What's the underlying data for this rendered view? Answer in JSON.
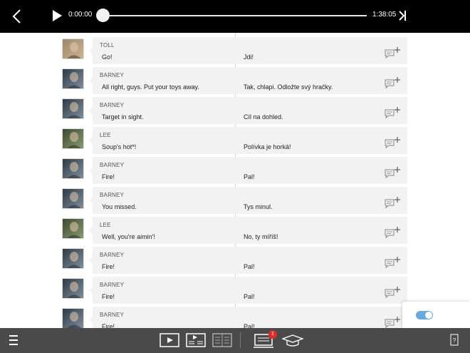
{
  "player": {
    "current_time": "0:00:00",
    "total_time": "1:38:05",
    "progress": 0.0
  },
  "subtitles": [
    {
      "speaker": "TOLL",
      "original": "Go!",
      "translation": "Jdi!",
      "avatar": "toll-avatar"
    },
    {
      "speaker": "BARNEY",
      "original": "All right, guys. Put your toys away.",
      "translation": "Tak, chlapi. Odložte svý hračky.",
      "avatar": "barney-avatar"
    },
    {
      "speaker": "BARNEY",
      "original": "Target in sight.",
      "translation": "Cíl na dohled.",
      "avatar": "barney-avatar"
    },
    {
      "speaker": "LEE",
      "original": "Soup's hot*!",
      "translation": "Polívka je horká!",
      "avatar": "lee-avatar"
    },
    {
      "speaker": "BARNEY",
      "original": "Fire!",
      "translation": "Pal!",
      "avatar": "barney-avatar"
    },
    {
      "speaker": "BARNEY",
      "original": "You missed.",
      "translation": "Tys minul.",
      "avatar": "barney-avatar"
    },
    {
      "speaker": "LEE",
      "original": "Well, you're aimin'!",
      "translation": "No, ty míříš!",
      "avatar": "lee-avatar"
    },
    {
      "speaker": "BARNEY",
      "original": "Fire!",
      "translation": "Pal!",
      "avatar": "barney-avatar"
    },
    {
      "speaker": "BARNEY",
      "original": "Fire!",
      "translation": "Pal!",
      "avatar": "barney-avatar"
    },
    {
      "speaker": "BARNEY",
      "original": "Fire!",
      "translation": "Pal!",
      "avatar": "barney-avatar"
    }
  ],
  "toolbar": {
    "notifications_badge": "1"
  },
  "colors": {
    "top_bar": "#000000",
    "bottom_bar": "#4a4a4a",
    "bubble": "#f2f2f2",
    "badge": "#e02b2b",
    "toggle": "#6aa8e0"
  }
}
